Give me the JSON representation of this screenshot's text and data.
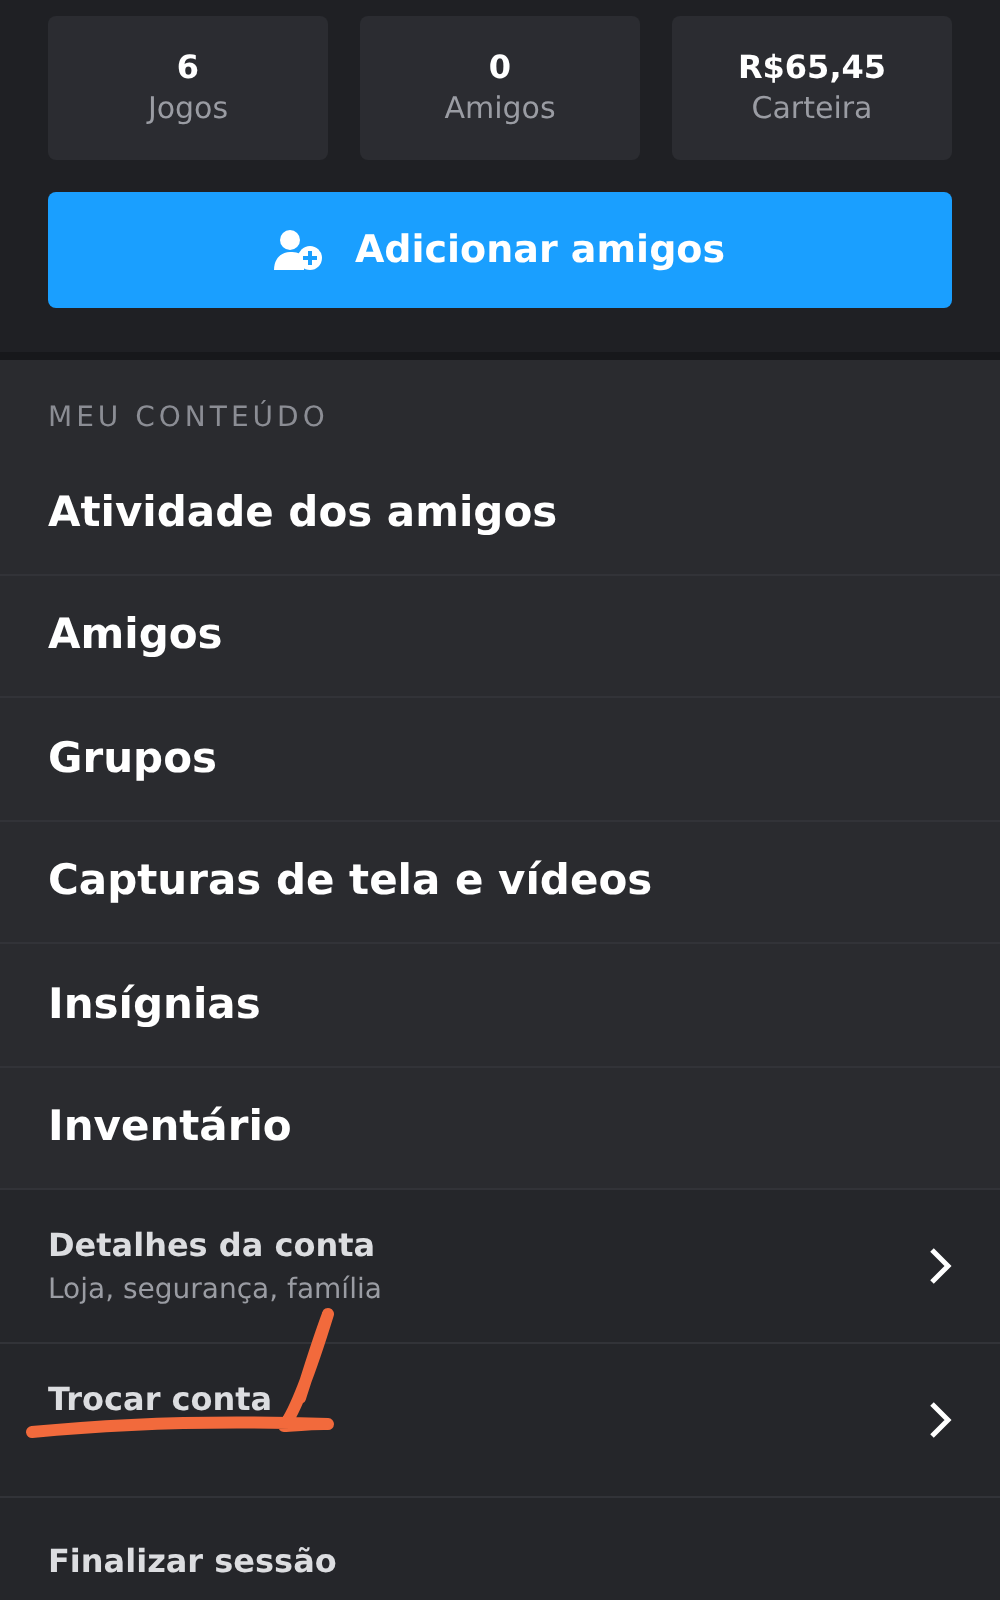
{
  "stats": [
    {
      "value": "6",
      "label": "Jogos"
    },
    {
      "value": "0",
      "label": "Amigos"
    },
    {
      "value": "R$65,45",
      "label": "Carteira"
    }
  ],
  "add_friends_button": "Adicionar amigos",
  "section_header": "MEU CONTEÚDO",
  "menu_items": [
    "Atividade dos amigos",
    "Amigos",
    "Grupos",
    "Capturas de tela e vídeos",
    "Insígnias",
    "Inventário"
  ],
  "account_items": [
    {
      "title": "Detalhes da conta",
      "subtitle": "Loja, segurança, família"
    },
    {
      "title": "Trocar conta"
    }
  ],
  "sign_out": "Finalizar sessão"
}
